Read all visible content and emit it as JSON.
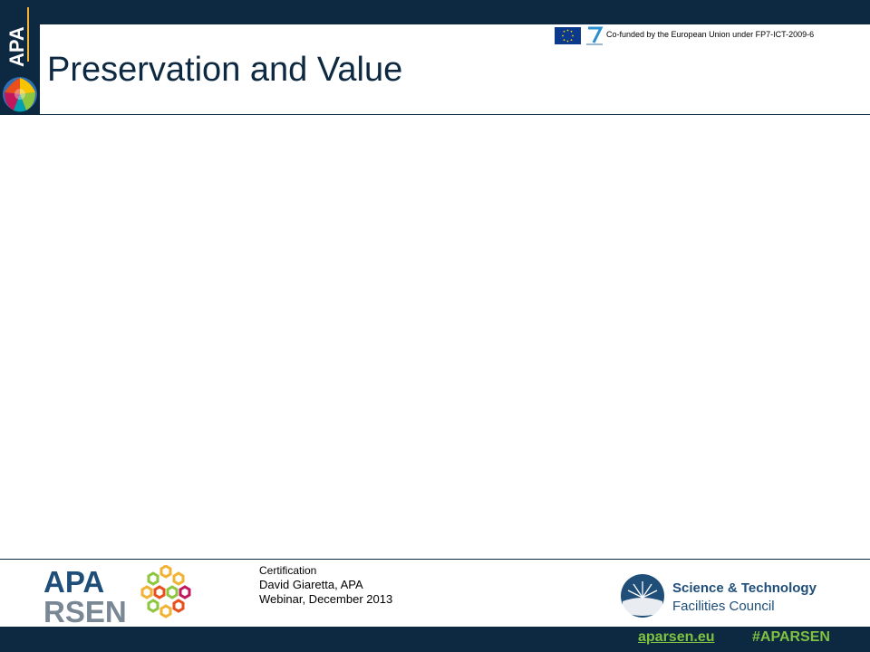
{
  "header": {
    "title": "Preservation and Value",
    "cofunded_text": "Co-funded by the European Union under FP7-ICT-2009-6",
    "sidebar_logo_text": "APA"
  },
  "footer": {
    "lines": [
      "Certification",
      "David Giaretta, APA",
      "Webinar, December 2013"
    ],
    "apa_logo_text": [
      "APA",
      "RSEN"
    ],
    "stfc_logo_text": [
      "Science & Technology",
      "Facilities Council"
    ],
    "link": "aparsen.eu",
    "hashtag": "#APARSEN"
  },
  "colors": {
    "navy": "#0d2841",
    "green": "#7fc241",
    "apa_blue": "#1f4e79",
    "rsen_gray": "#7a8794"
  }
}
